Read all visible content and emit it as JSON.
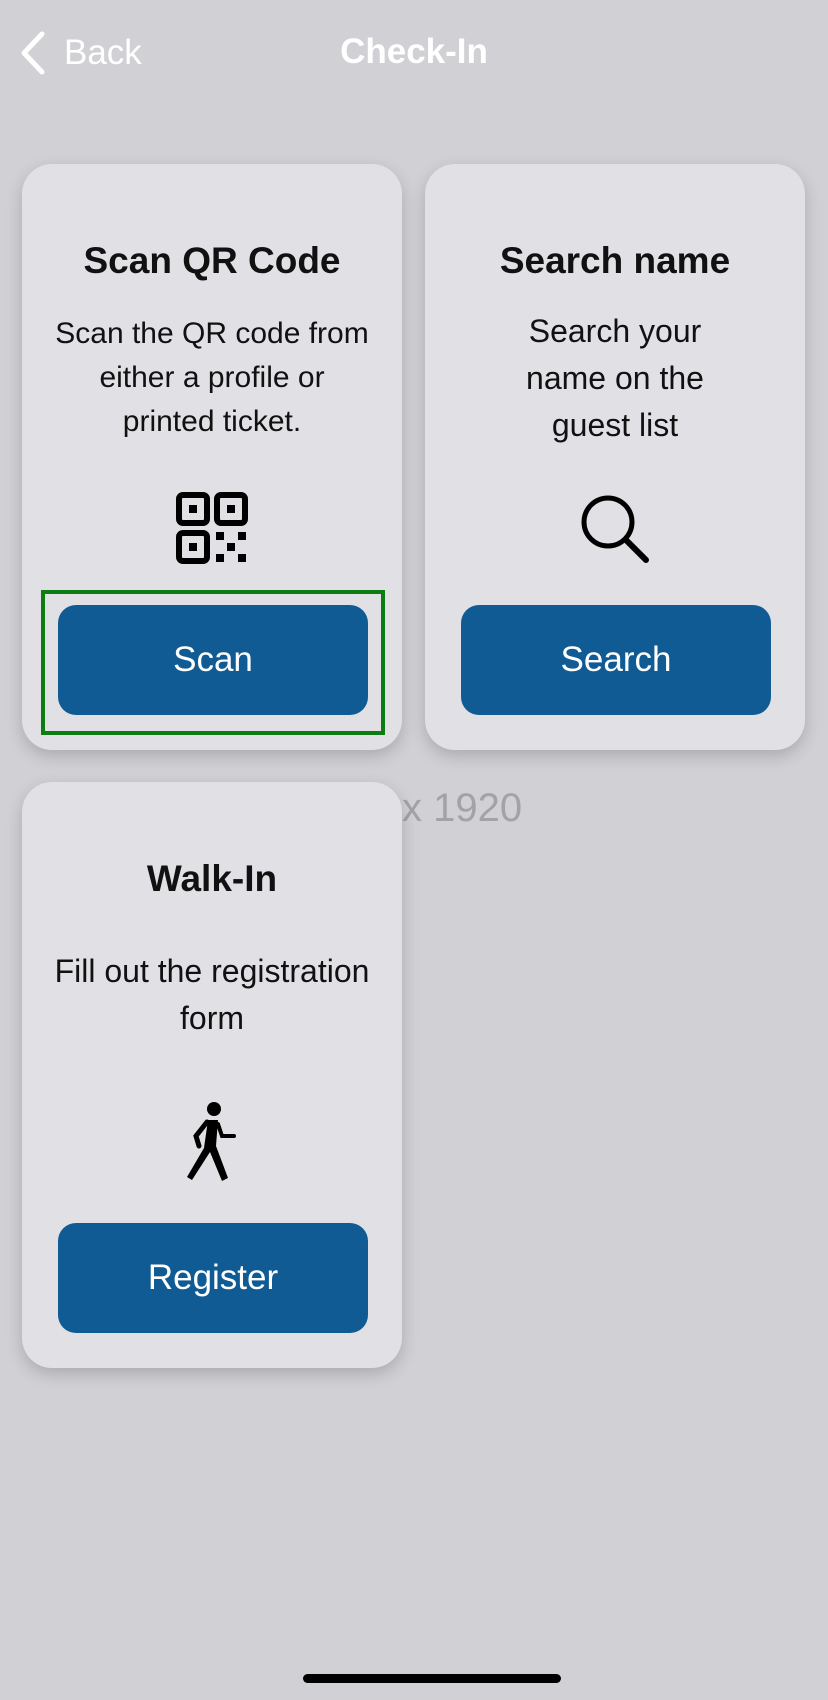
{
  "nav": {
    "back_label": "Back",
    "title": "Check-In"
  },
  "cards": [
    {
      "title": "Scan QR Code",
      "description": "Scan the QR code from either a profile or printed ticket.",
      "icon": "qr-code-icon",
      "button": "Scan"
    },
    {
      "title": "Search name",
      "description": "Search your name on the guest list",
      "icon": "magnifying-glass-icon",
      "button": "Search"
    },
    {
      "title": "Walk-In",
      "description": "Fill out the registration form",
      "icon": "person-walking-icon",
      "button": "Register"
    }
  ],
  "overlay_text": "x 1920",
  "colors": {
    "background": "#d1d0d4",
    "card": "#e1e0e4",
    "button": "#105b94",
    "focus_outline": "#0d7d12"
  }
}
